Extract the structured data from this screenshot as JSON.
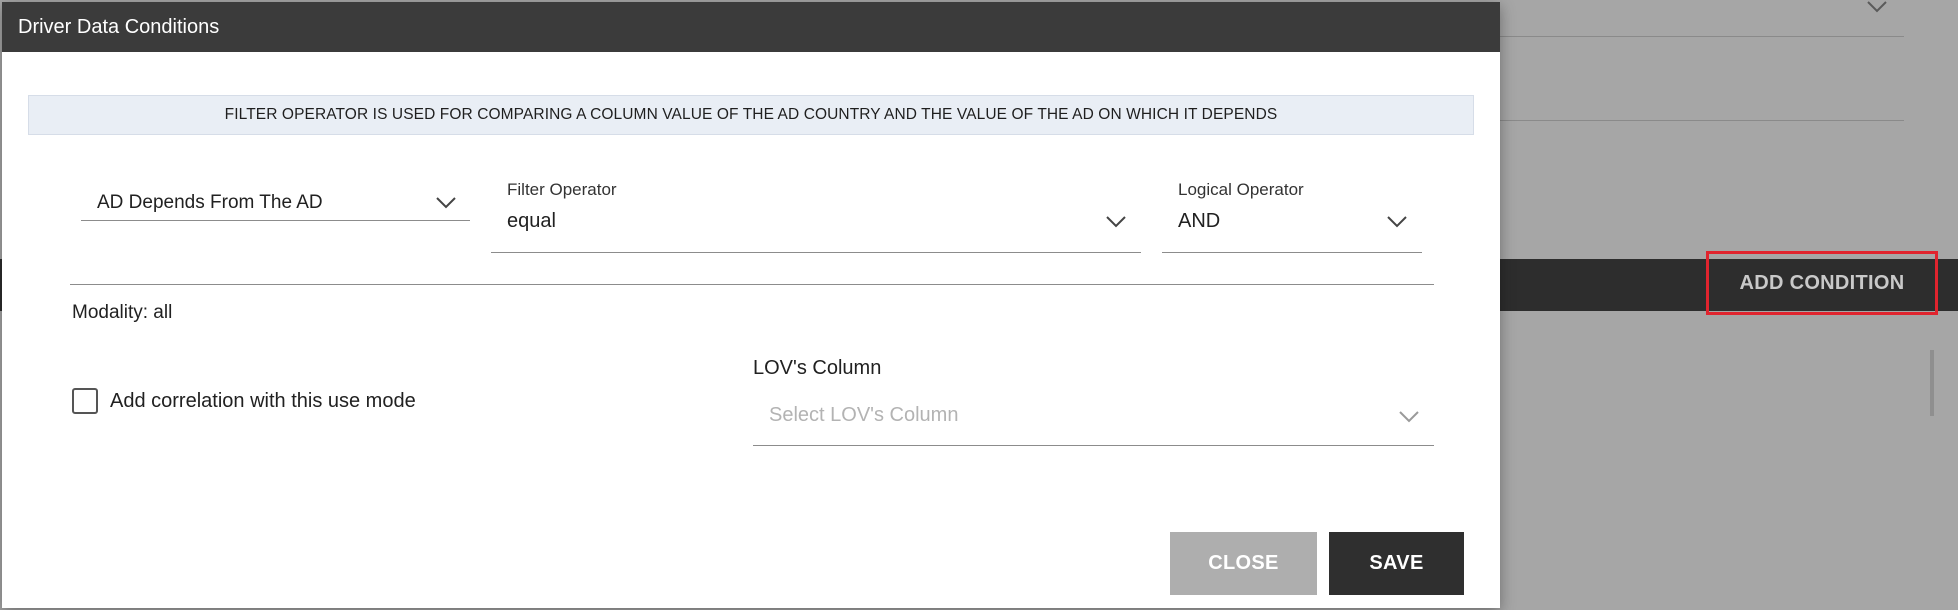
{
  "background": {
    "add_condition_label": "ADD CONDITION"
  },
  "dialog": {
    "title": "Driver Data Conditions",
    "banner": "FILTER OPERATOR IS USED FOR COMPARING A COLUMN VALUE OF THE AD COUNTRY AND THE VALUE OF THE AD ON WHICH IT DEPENDS",
    "depends_select": {
      "value": "AD Depends From The AD"
    },
    "filter_operator": {
      "label": "Filter Operator",
      "value": "equal"
    },
    "logical_operator": {
      "label": "Logical Operator",
      "value": "AND"
    },
    "modality": "Modality: all",
    "correlation_checkbox": {
      "label": "Add correlation with this use mode",
      "checked": false
    },
    "lov_column": {
      "label": "LOV's Column",
      "placeholder": "Select LOV's Column"
    },
    "buttons": {
      "close": "CLOSE",
      "save": "SAVE"
    }
  },
  "colors": {
    "header_bg": "#3b3b3b",
    "banner_bg": "#e9eef5",
    "save_bg": "#2f2f2f",
    "close_bg": "#aeaeae",
    "highlight_border": "#e0242e"
  },
  "icons": {
    "dropdown": "chevron-down-icon"
  }
}
